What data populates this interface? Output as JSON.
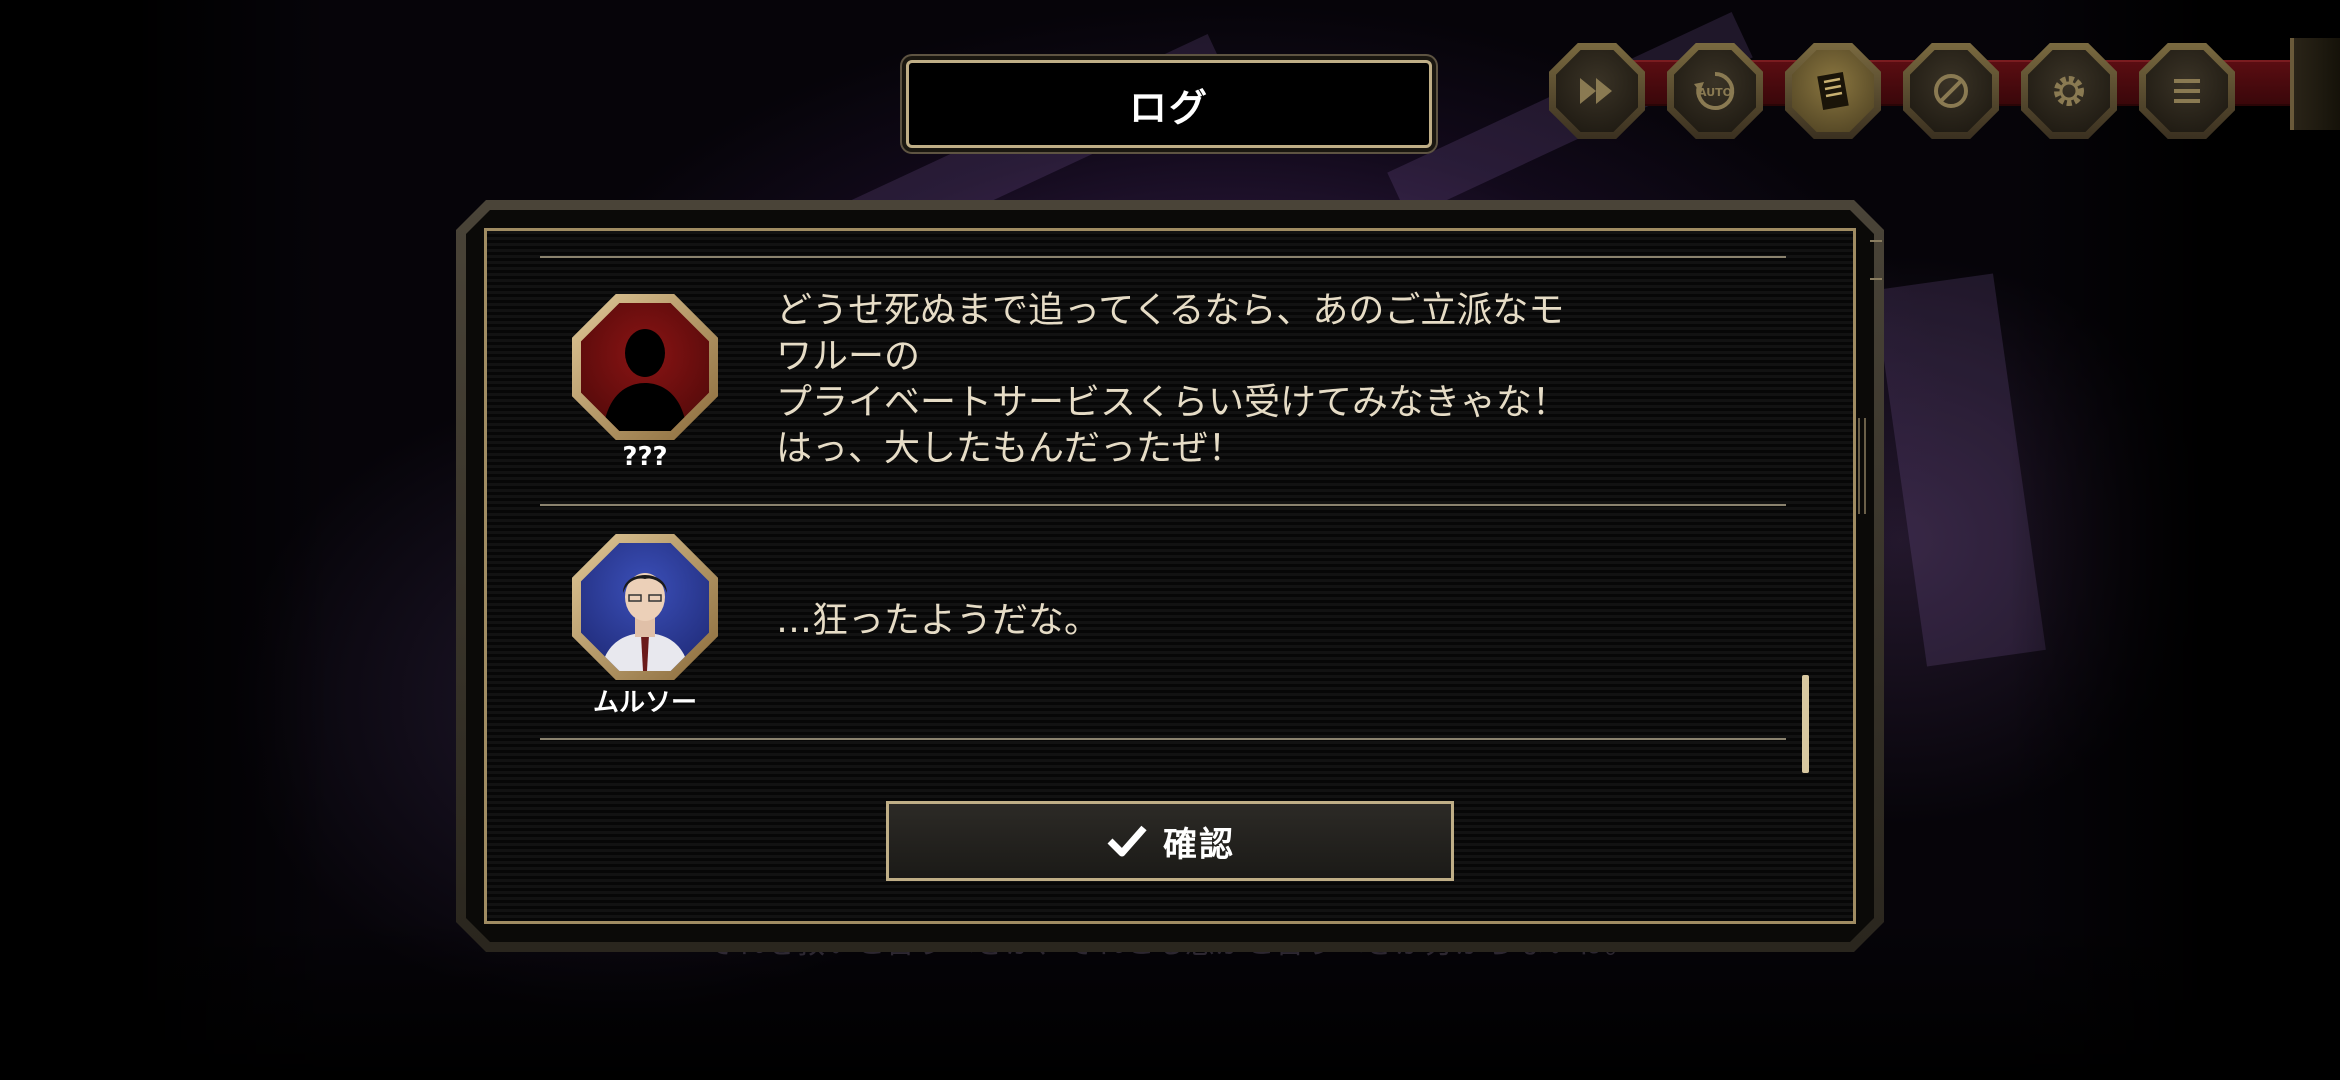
{
  "background": {
    "underlying_text": "それを救いと言うべきか、それとも愚かと言うべきか分からないね。"
  },
  "toolbar": {
    "buttons": [
      {
        "id": "fast-forward",
        "icon": "fast-forward-icon"
      },
      {
        "id": "auto",
        "icon": "auto-icon",
        "label": "AUTO"
      },
      {
        "id": "log",
        "icon": "log-document-icon"
      },
      {
        "id": "hide-ui",
        "icon": "hide-icon"
      },
      {
        "id": "settings",
        "icon": "gear-icon"
      },
      {
        "id": "menu",
        "icon": "menu-icon"
      }
    ]
  },
  "log_panel": {
    "title": "ログ",
    "entries": [
      {
        "speaker": "???",
        "avatar": "silhouette-avatar",
        "avatar_color": "#7a1010",
        "text": "どうせ死ぬまで追ってくるなら、あのご立派なモ\nワルーの\nプライベートサービスくらい受けてみなきゃな！\nはっ、大したもんだったぜ！"
      },
      {
        "speaker": "ムルソー",
        "avatar": "meursault-portrait",
        "avatar_color": "#2a3a9a",
        "text": "…狂ったようだな。"
      }
    ],
    "confirm_label": "確認"
  },
  "colors": {
    "frame_gold": "#bfae86",
    "text": "#e6dcc6",
    "toolbar_track": "#5a0d12"
  }
}
